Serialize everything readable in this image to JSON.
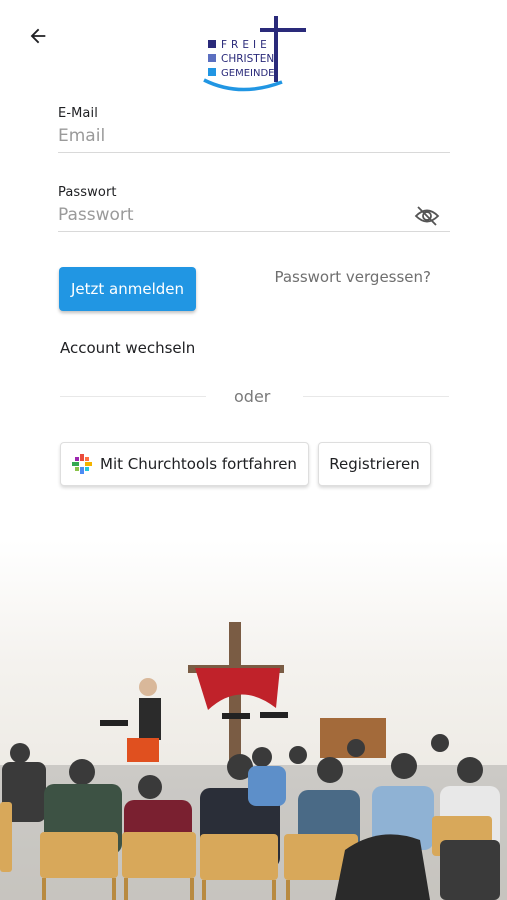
{
  "logo": {
    "line1": "FREIE",
    "line2": "CHRISTEN",
    "line3": "GEMEINDE",
    "colors": {
      "cross": "#2a2a7a",
      "square1": "#2a2a7a",
      "square2": "#5b6fc0",
      "square3": "#2196e3",
      "swoosh": "#2196e3"
    }
  },
  "header": {
    "back_icon": "arrow-left-icon"
  },
  "form": {
    "email_label": "E-Mail",
    "email_placeholder": "Email",
    "email_value": "",
    "password_label": "Passwort",
    "password_placeholder": "Passwort",
    "password_value": "",
    "password_toggle_icon": "eye-off-icon"
  },
  "actions": {
    "login_label": "Jetzt anmelden",
    "forgot_label": "Passwort vergessen?",
    "switch_account_label": "Account wechseln",
    "divider_label": "oder",
    "churchtools_label": "Mit Churchtools fortfahren",
    "register_label": "Registrieren"
  },
  "theme": {
    "primary": "#2196e3",
    "text": "#202124",
    "muted": "#9a9a9a"
  }
}
